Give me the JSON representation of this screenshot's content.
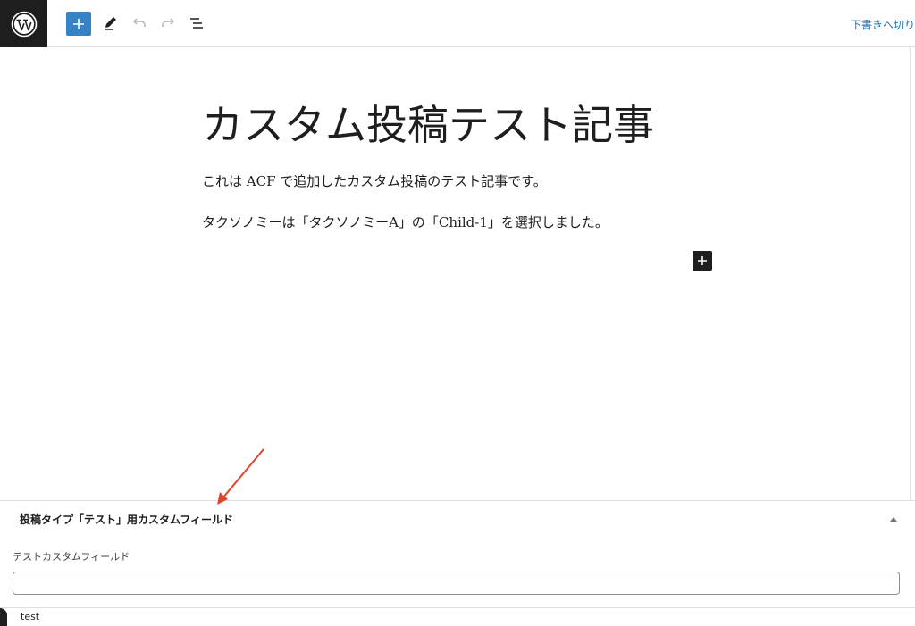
{
  "toolbar": {
    "logo_icon": "wordpress-logo-icon",
    "add_block_icon": "plus-icon",
    "tools_icon": "pencil-icon",
    "undo_icon": "undo-icon",
    "redo_icon": "redo-icon",
    "list_view_icon": "list-view-icon",
    "save_draft_label": "下書きへ切り"
  },
  "editor": {
    "title": "カスタム投稿テスト記事",
    "paragraphs": [
      "これは ACF で追加したカスタム投稿のテスト記事です。",
      "タクソノミーは「タクソノミーA」の「Child-1」を選択しました。"
    ],
    "inserter_icon": "plus-icon"
  },
  "metabox": {
    "title": "投稿タイプ「テスト」用カスタムフィールド",
    "toggle_icon": "triangle-up-icon",
    "field_label": "テストカスタムフィールド",
    "field_value": ""
  },
  "footer": {
    "breadcrumb": "test"
  },
  "colors": {
    "accent": "#3582c4",
    "link": "#2271b1",
    "dark": "#1e1e1e",
    "annotation_arrow": "#e2432a"
  },
  "annotation": {
    "icon": "red-arrow-icon"
  }
}
